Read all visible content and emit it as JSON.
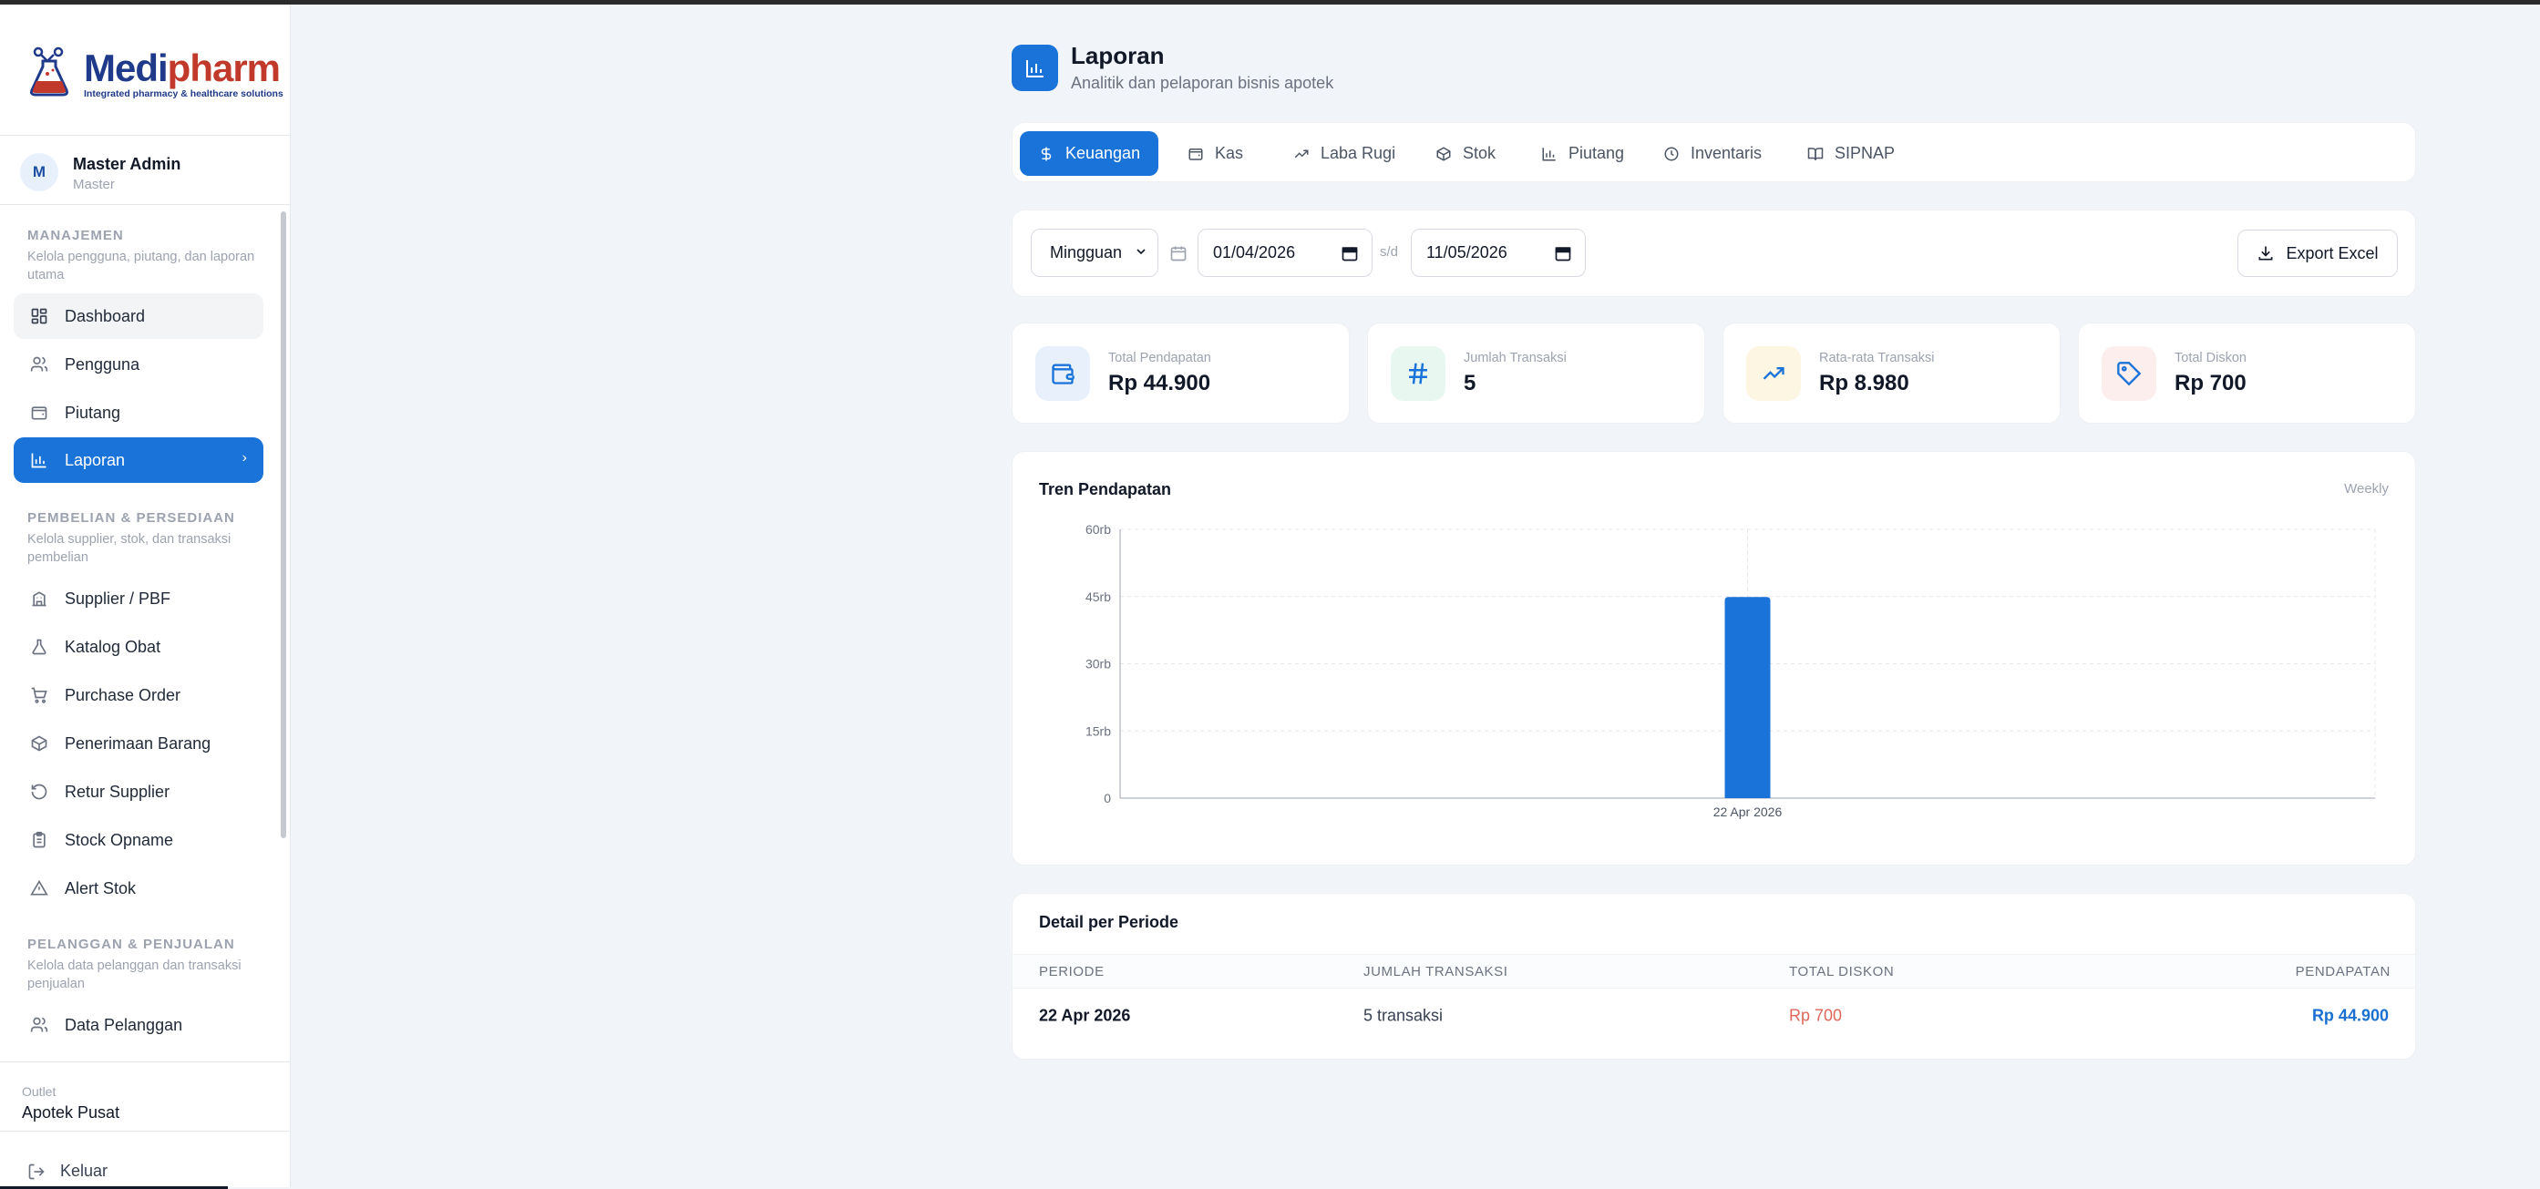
{
  "app": {
    "logo_part1": "Medi",
    "logo_part2": "pharm",
    "tagline": "Integrated pharmacy & healthcare solutions"
  },
  "user": {
    "initial": "M",
    "name": "Master Admin",
    "role": "Master"
  },
  "sidebar": {
    "sections": [
      {
        "title": "MANAJEMEN",
        "desc": "Kelola pengguna, piutang, dan laporan utama"
      },
      {
        "title": "PEMBELIAN & PERSEDIAAN",
        "desc": "Kelola supplier, stok, dan transaksi pembelian"
      },
      {
        "title": "PELANGGAN & PENJUALAN",
        "desc": "Kelola data pelanggan dan transaksi penjualan"
      }
    ],
    "items": [
      {
        "label": "Dashboard",
        "icon": "grid-icon"
      },
      {
        "label": "Pengguna",
        "icon": "users-icon"
      },
      {
        "label": "Piutang",
        "icon": "wallet-icon"
      },
      {
        "label": "Laporan",
        "icon": "bar-chart-icon",
        "active": true
      },
      {
        "label": "Supplier / PBF",
        "icon": "building-icon"
      },
      {
        "label": "Katalog Obat",
        "icon": "flask-icon"
      },
      {
        "label": "Purchase Order",
        "icon": "cart-icon"
      },
      {
        "label": "Penerimaan Barang",
        "icon": "package-icon"
      },
      {
        "label": "Retur Supplier",
        "icon": "rotate-ccw-icon"
      },
      {
        "label": "Stock Opname",
        "icon": "clipboard-icon"
      },
      {
        "label": "Alert Stok",
        "icon": "alert-triangle-icon"
      },
      {
        "label": "Data Pelanggan",
        "icon": "users-icon"
      }
    ],
    "outlet_label": "Outlet",
    "outlet_name": "Apotek Pusat",
    "logout": "Keluar"
  },
  "page": {
    "title": "Laporan",
    "subtitle": "Analitik dan pelaporan bisnis apotek"
  },
  "tabs": [
    {
      "label": "Keuangan",
      "icon": "dollar-icon",
      "active": true
    },
    {
      "label": "Kas",
      "icon": "wallet-icon"
    },
    {
      "label": "Laba Rugi",
      "icon": "trending-up-icon"
    },
    {
      "label": "Stok",
      "icon": "box-icon"
    },
    {
      "label": "Piutang",
      "icon": "bar-chart-icon"
    },
    {
      "label": "Inventaris",
      "icon": "clock-icon"
    },
    {
      "label": "SIPNAP",
      "icon": "book-icon"
    }
  ],
  "filters": {
    "period": "Mingguan",
    "date_from": "01/04/2026",
    "separator": "s/d",
    "date_to": "11/05/2026",
    "export_label": "Export Excel"
  },
  "stats": [
    {
      "label": "Total Pendapatan",
      "value": "Rp 44.900",
      "icon": "wallet-icon",
      "color": "#1a73d8",
      "bg": "#e8f0fc"
    },
    {
      "label": "Jumlah Transaksi",
      "value": "5",
      "icon": "hash-icon",
      "color": "#1a73d8",
      "bg": "#e9f7f1"
    },
    {
      "label": "Rata-rata Transaksi",
      "value": "Rp 8.980",
      "icon": "trending-up-icon",
      "color": "#1a73d8",
      "bg": "#fdf6e3"
    },
    {
      "label": "Total Diskon",
      "value": "Rp 700",
      "icon": "tag-icon",
      "color": "#1a73d8",
      "bg": "#fdeeee"
    }
  ],
  "chart": {
    "title": "Tren Pendapatan",
    "period_label": "Weekly"
  },
  "chart_data": {
    "type": "bar",
    "title": "Tren Pendapatan",
    "categories": [
      "22 Apr 2026"
    ],
    "values": [
      44900
    ],
    "ylim": [
      0,
      60000
    ],
    "yticks": [
      0,
      15000,
      30000,
      45000,
      60000
    ],
    "ytick_labels": [
      "0",
      "15rb",
      "30rb",
      "45rb",
      "60rb"
    ],
    "bar_color": "#1a73d8",
    "grid": true
  },
  "table": {
    "title": "Detail per Periode",
    "headers": [
      "PERIODE",
      "JUMLAH TRANSAKSI",
      "TOTAL DISKON",
      "PENDAPATAN"
    ],
    "rows": [
      {
        "period": "22 Apr 2026",
        "transactions": "5 transaksi",
        "discount": "Rp 700",
        "revenue": "Rp 44.900"
      }
    ],
    "discount_color": "#e0665a",
    "revenue_color": "#1a6fd0"
  }
}
